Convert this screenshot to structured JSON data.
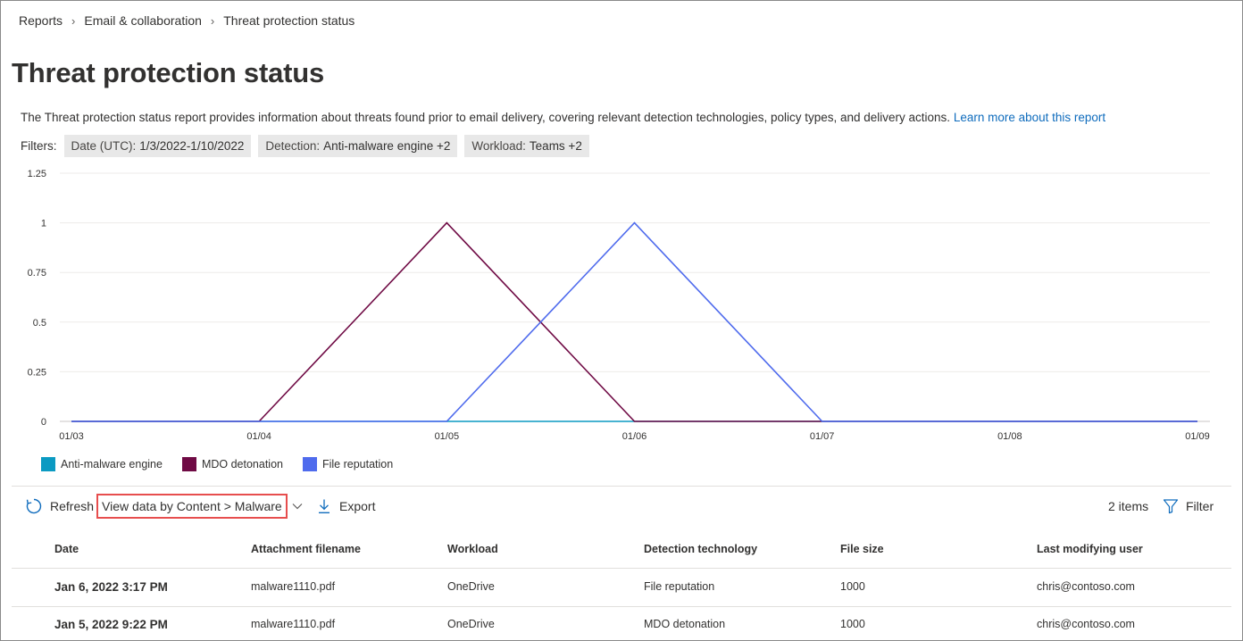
{
  "breadcrumb": [
    "Reports",
    "Email & collaboration",
    "Threat protection status"
  ],
  "page_title": "Threat protection status",
  "description": {
    "text": "The Threat protection status report provides information about threats found prior to email delivery, covering relevant detection technologies, policy types, and delivery actions.",
    "link": "Learn more about this report"
  },
  "filters": {
    "label": "Filters:",
    "items": [
      {
        "key": "Date (UTC):",
        "value": "1/3/2022-1/10/2022"
      },
      {
        "key": "Detection:",
        "value": "Anti-malware engine +2"
      },
      {
        "key": "Workload:",
        "value": "Teams +2"
      }
    ]
  },
  "chart_data": {
    "type": "line",
    "x": [
      "01/03",
      "01/04",
      "01/05",
      "01/06",
      "01/07",
      "01/08",
      "01/09"
    ],
    "yticks": [
      "0",
      "0.25",
      "0.5",
      "0.75",
      "1",
      "1.25"
    ],
    "ylim": [
      0,
      1.25
    ],
    "grid": true,
    "legend_position": "bottom-left",
    "series": [
      {
        "name": "Anti-malware engine",
        "color": "#0b9ac2",
        "values": [
          0,
          0,
          0,
          0,
          0,
          0,
          0
        ]
      },
      {
        "name": "MDO detonation",
        "color": "#6f0a44",
        "values": [
          0,
          0,
          1,
          0,
          0,
          0,
          0
        ]
      },
      {
        "name": "File reputation",
        "color": "#4f6bed",
        "values": [
          0,
          0,
          0,
          1,
          0,
          0,
          0
        ]
      }
    ]
  },
  "toolbar": {
    "refresh_label": "Refresh",
    "view_label": "View data by Content > Malware",
    "export_label": "Export",
    "items_count": "2 items",
    "filter_label": "Filter"
  },
  "table": {
    "columns": [
      "Date",
      "Attachment filename",
      "Workload",
      "Detection technology",
      "File size",
      "Last modifying user"
    ],
    "rows": [
      [
        "Jan 6, 2022 3:17 PM",
        "malware1110.pdf",
        "OneDrive",
        "File reputation",
        "1000",
        "chris@contoso.com"
      ],
      [
        "Jan 5, 2022 9:22 PM",
        "malware1110.pdf",
        "OneDrive",
        "MDO detonation",
        "1000",
        "chris@contoso.com"
      ]
    ]
  },
  "colors": {
    "link": "#0f6cbd",
    "highlight_border": "#e74e4e"
  }
}
